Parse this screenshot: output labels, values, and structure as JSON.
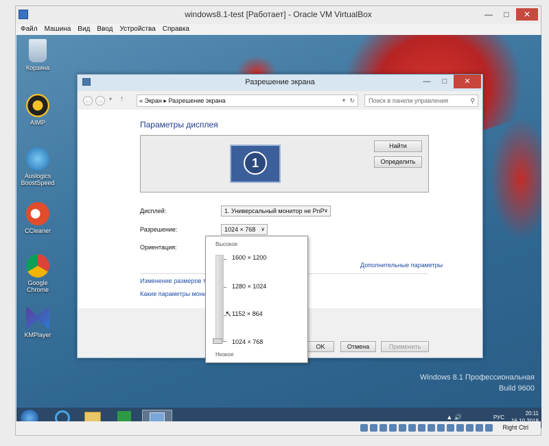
{
  "vbox": {
    "title": "windows8.1-test [Работает] - Oracle VM VirtualBox",
    "menu": [
      "Файл",
      "Машина",
      "Вид",
      "Ввод",
      "Устройства",
      "Справка"
    ],
    "host_key": "Right Ctrl"
  },
  "desktop_icons": [
    {
      "label": "Корзина",
      "icon": "recycle-bin-icon"
    },
    {
      "label": "AIMP",
      "icon": "aimp-icon"
    },
    {
      "label": "Auslogics BoostSpeed",
      "icon": "boostspeed-icon"
    },
    {
      "label": "CCleaner",
      "icon": "ccleaner-icon"
    },
    {
      "label": "Google Chrome",
      "icon": "chrome-icon"
    },
    {
      "label": "KMPlayer",
      "icon": "kmplayer-icon"
    }
  ],
  "watermark": {
    "line1": "Windows 8.1 Профессиональная",
    "line2": "Build 9600"
  },
  "dialog": {
    "title": "Разрешение экрана",
    "address": {
      "part1": "Экран",
      "part2": "Разрешение экрана"
    },
    "search_placeholder": "Поиск в панели управления",
    "heading": "Параметры дисплея",
    "monitor_number": "1",
    "find_button": "Найти",
    "identify_button": "Определить",
    "display_label": "Дисплей:",
    "display_value": "1. Универсальный монитор не PnP",
    "resolution_label": "Разрешение:",
    "resolution_value": "1024 × 768",
    "orientation_label": "Ориентация:",
    "advanced_link": "Дополнительные параметры",
    "link_text_size": "Изменение размеров те",
    "link_which": "Какие параметры мони",
    "ok": "OK",
    "cancel": "Отмена",
    "apply": "Применить"
  },
  "slider_popup": {
    "high": "Высокое",
    "low": "Низкое",
    "options": [
      "1600 × 1200",
      "1280 × 1024",
      "1152 × 864",
      "1024 × 768"
    ],
    "selected": "1024 × 768"
  },
  "taskbar": {
    "lang": "РУС",
    "time": "20:11",
    "date": "16.10.2018"
  }
}
